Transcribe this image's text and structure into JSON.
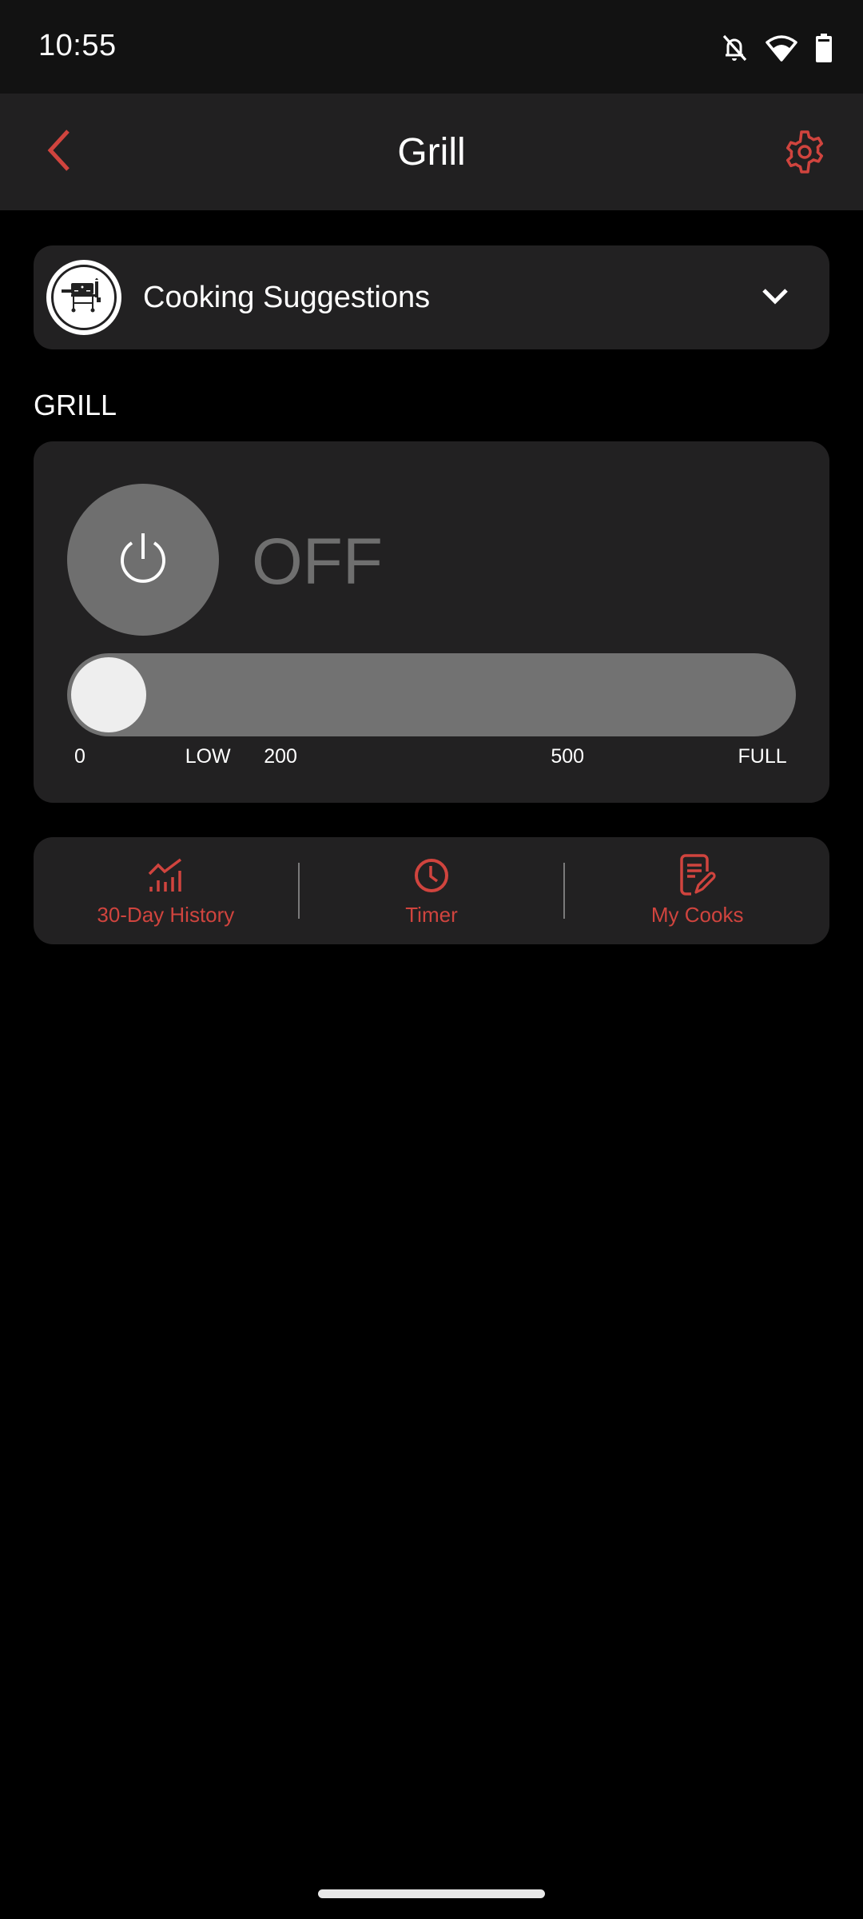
{
  "status_bar": {
    "time": "10:55",
    "icons": [
      "notifications-off-icon",
      "wifi-icon",
      "battery-icon"
    ]
  },
  "app_bar": {
    "title": "Grill",
    "back_icon": "chevron-left-icon",
    "settings_icon": "gear-icon"
  },
  "suggestions": {
    "label": "Cooking Suggestions",
    "avatar_icon": "grill-icon",
    "expand_icon": "chevron-down-icon"
  },
  "grill": {
    "section_label": "GRILL",
    "power_icon": "power-icon",
    "state": "OFF",
    "slider": {
      "value_fraction": 0,
      "ticks": [
        {
          "label": "0",
          "position": 0.0
        },
        {
          "label": "LOW",
          "position": 0.178
        },
        {
          "label": "200",
          "position": 0.279
        },
        {
          "label": "500",
          "position": 0.678
        },
        {
          "label": "FULL",
          "position": 0.949
        }
      ]
    }
  },
  "actions": [
    {
      "label": "30-Day History",
      "icon": "chart-trend-icon"
    },
    {
      "label": "Timer",
      "icon": "clock-icon"
    },
    {
      "label": "My Cooks",
      "icon": "document-edit-icon"
    }
  ],
  "colors": {
    "accent": "#d0443e",
    "background": "#000000",
    "card": "#222122",
    "app_bar": "#212021",
    "status_bar": "#121212",
    "inactive": "#6f6f6f"
  }
}
